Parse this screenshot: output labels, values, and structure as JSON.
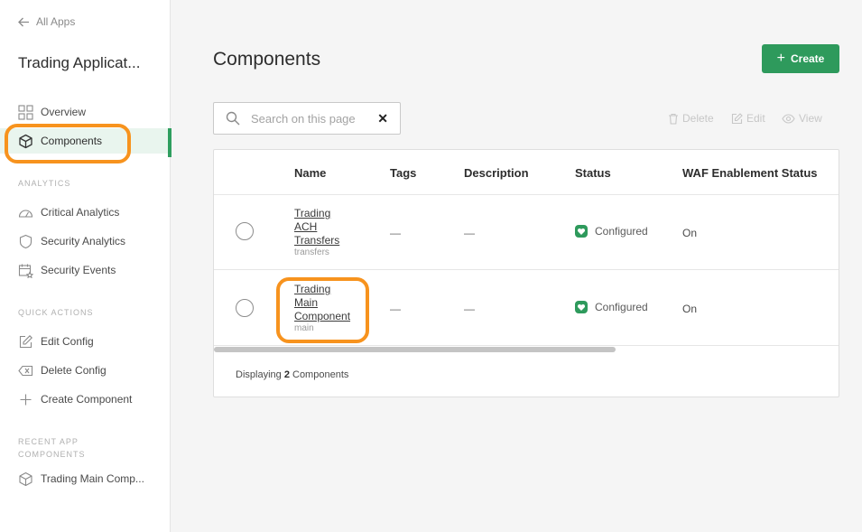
{
  "sidebar": {
    "back_label": "All Apps",
    "app_title": "Trading Applicat...",
    "nav": [
      {
        "label": "Overview",
        "icon": "grid-icon"
      },
      {
        "label": "Components",
        "icon": "cube-icon",
        "active": true
      }
    ],
    "analytics_label": "ANALYTICS",
    "analytics": [
      {
        "label": "Critical Analytics",
        "icon": "gauge-icon"
      },
      {
        "label": "Security Analytics",
        "icon": "shield-icon"
      },
      {
        "label": "Security Events",
        "icon": "calendar-star-icon"
      }
    ],
    "quick_label": "QUICK ACTIONS",
    "quick": [
      {
        "label": "Edit Config",
        "icon": "edit-icon"
      },
      {
        "label": "Delete Config",
        "icon": "backspace-icon"
      },
      {
        "label": "Create Component",
        "icon": "plus-icon"
      }
    ],
    "recent_label_1": "RECENT APP",
    "recent_label_2": "COMPONENTS",
    "recent": [
      {
        "label": "Trading Main Comp...",
        "icon": "cube-icon"
      }
    ]
  },
  "main": {
    "title": "Components",
    "create_label": "Create",
    "search_placeholder": "Search on this page",
    "actions": {
      "delete": "Delete",
      "edit": "Edit",
      "view": "View"
    },
    "columns": [
      "Name",
      "Tags",
      "Description",
      "Status",
      "WAF Enablement Status"
    ],
    "rows": [
      {
        "name_1": "Trading",
        "name_2": "ACH",
        "name_3": "Transfers",
        "sub": "transfers",
        "tags": "—",
        "description": "—",
        "status": "Configured",
        "waf": "On"
      },
      {
        "name_1": "Trading",
        "name_2": "Main",
        "name_3": "Component",
        "sub": "main",
        "tags": "—",
        "description": "—",
        "status": "Configured",
        "waf": "On"
      }
    ],
    "footer_prefix": "Displaying",
    "footer_count": "2",
    "footer_suffix": "Components"
  },
  "colors": {
    "accent": "#2e9a5c",
    "highlight": "#f7931e"
  }
}
